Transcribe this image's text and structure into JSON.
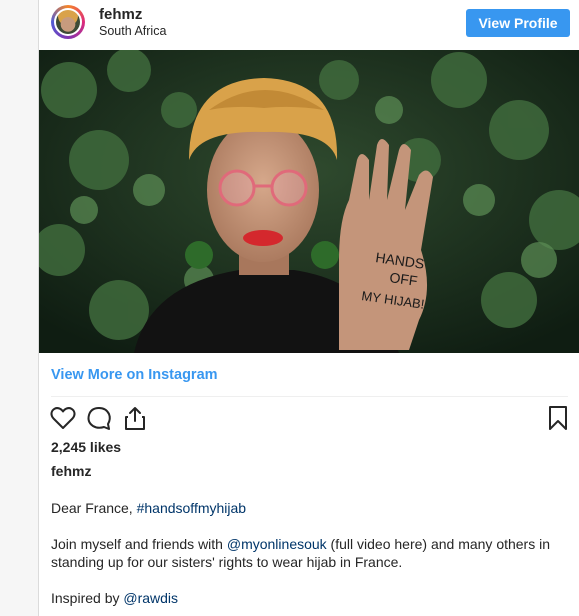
{
  "header": {
    "username": "fehmz",
    "location": "South Africa",
    "view_profile_label": "View Profile"
  },
  "photo": {
    "hand_text_line1": "HANDS",
    "hand_text_line2": "OFF",
    "hand_text_line3": "MY HIJAB!"
  },
  "view_more_label": "View More on Instagram",
  "actions": {
    "icons": [
      "heart-icon",
      "comment-icon",
      "share-icon",
      "bookmark-icon"
    ]
  },
  "likes": "2,245 likes",
  "caption": {
    "author": "fehmz",
    "line1_prefix": "Dear France, ",
    "line1_tag": "#handsoffmyhijab",
    "line2_prefix": "Join myself and friends with ",
    "line2_mention": "@myonlinesouk",
    "line2_suffix": " (full video here) and many others in standing up for our sisters' rights to wear hijab in France.",
    "line3_prefix": "Inspired by ",
    "line3_mention": "@rawdis"
  },
  "colors": {
    "accent": "#3897f0",
    "link": "#003569",
    "text": "#262626"
  }
}
